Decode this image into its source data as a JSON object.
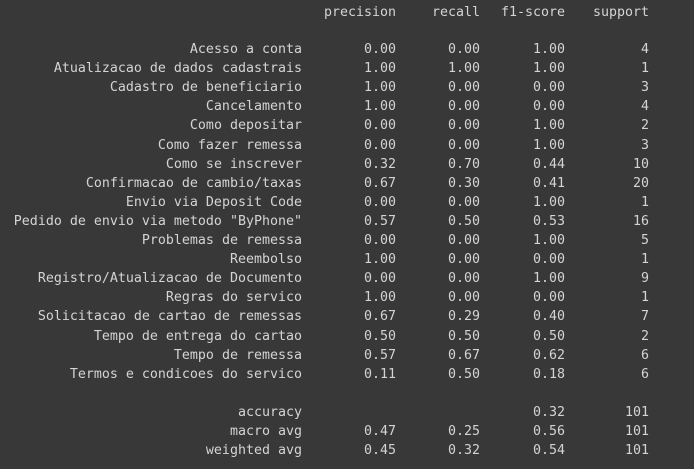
{
  "header": {
    "precision": "precision",
    "recall": "recall",
    "f1": "f1-score",
    "support": "support"
  },
  "rows": [
    {
      "label": "Acesso a conta",
      "precision": "0.00",
      "recall": "0.00",
      "f1": "1.00",
      "support": "4"
    },
    {
      "label": "Atualizacao de dados cadastrais",
      "precision": "1.00",
      "recall": "1.00",
      "f1": "1.00",
      "support": "1"
    },
    {
      "label": "Cadastro de beneficiario",
      "precision": "1.00",
      "recall": "0.00",
      "f1": "0.00",
      "support": "3"
    },
    {
      "label": "Cancelamento",
      "precision": "1.00",
      "recall": "0.00",
      "f1": "0.00",
      "support": "4"
    },
    {
      "label": "Como depositar",
      "precision": "0.00",
      "recall": "0.00",
      "f1": "1.00",
      "support": "2"
    },
    {
      "label": "Como fazer remessa",
      "precision": "0.00",
      "recall": "0.00",
      "f1": "1.00",
      "support": "3"
    },
    {
      "label": "Como se inscrever",
      "precision": "0.32",
      "recall": "0.70",
      "f1": "0.44",
      "support": "10"
    },
    {
      "label": "Confirmacao de cambio/taxas",
      "precision": "0.67",
      "recall": "0.30",
      "f1": "0.41",
      "support": "20"
    },
    {
      "label": "Envio via Deposit Code",
      "precision": "0.00",
      "recall": "0.00",
      "f1": "1.00",
      "support": "1"
    },
    {
      "label": "Pedido de envio via metodo \"ByPhone\"",
      "precision": "0.57",
      "recall": "0.50",
      "f1": "0.53",
      "support": "16"
    },
    {
      "label": "Problemas de remessa",
      "precision": "0.00",
      "recall": "0.00",
      "f1": "1.00",
      "support": "5"
    },
    {
      "label": "Reembolso",
      "precision": "1.00",
      "recall": "0.00",
      "f1": "0.00",
      "support": "1"
    },
    {
      "label": "Registro/Atualizacao de Documento",
      "precision": "0.00",
      "recall": "0.00",
      "f1": "1.00",
      "support": "9"
    },
    {
      "label": "Regras do servico",
      "precision": "1.00",
      "recall": "0.00",
      "f1": "0.00",
      "support": "1"
    },
    {
      "label": "Solicitacao de cartao de remessas",
      "precision": "0.67",
      "recall": "0.29",
      "f1": "0.40",
      "support": "7"
    },
    {
      "label": "Tempo de entrega do cartao",
      "precision": "0.50",
      "recall": "0.50",
      "f1": "0.50",
      "support": "2"
    },
    {
      "label": "Tempo de remessa",
      "precision": "0.57",
      "recall": "0.67",
      "f1": "0.62",
      "support": "6"
    },
    {
      "label": "Termos e condicoes do servico",
      "precision": "0.11",
      "recall": "0.50",
      "f1": "0.18",
      "support": "6"
    }
  ],
  "summary": [
    {
      "label": "accuracy",
      "precision": "",
      "recall": "",
      "f1": "0.32",
      "support": "101"
    },
    {
      "label": "macro avg",
      "precision": "0.47",
      "recall": "0.25",
      "f1": "0.56",
      "support": "101"
    },
    {
      "label": "weighted avg",
      "precision": "0.45",
      "recall": "0.32",
      "f1": "0.54",
      "support": "101"
    }
  ]
}
